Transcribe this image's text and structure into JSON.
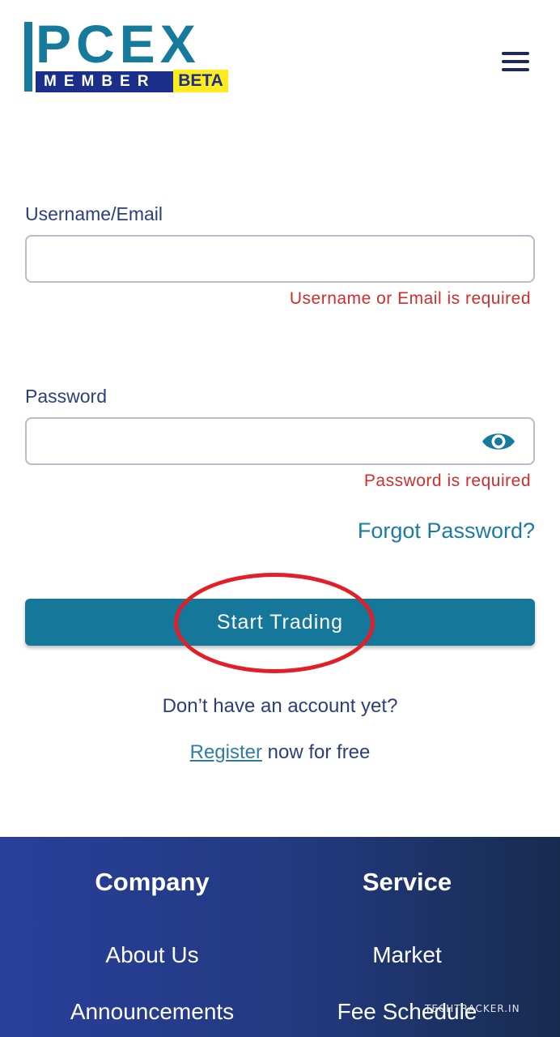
{
  "brand": {
    "logo_main": "PCEX",
    "logo_sub": "MEMBER",
    "logo_badge": "BETA",
    "accent_color": "#157a9b",
    "navy_color": "#1a2e8a",
    "badge_color": "#ffeb1f"
  },
  "header": {
    "menu_icon": "hamburger-menu-icon"
  },
  "form": {
    "username_label": "Username/Email",
    "username_value": "",
    "username_error": "Username or Email is required",
    "password_label": "Password",
    "password_value": "",
    "password_error": "Password is required",
    "password_toggle_icon": "eye-icon",
    "forgot_label": "Forgot Password?",
    "submit_label": "Start Trading",
    "no_account_text": "Don’t have an account yet?",
    "register_link": "Register",
    "register_suffix": " now for free",
    "error_color": "#d22d2d"
  },
  "footer": {
    "company_title": "Company",
    "company_links": [
      "About Us",
      "Announcements"
    ],
    "service_title": "Service",
    "service_links": [
      "Market",
      "Fee Schedule"
    ]
  },
  "watermark": "TECHTRACKER.IN"
}
